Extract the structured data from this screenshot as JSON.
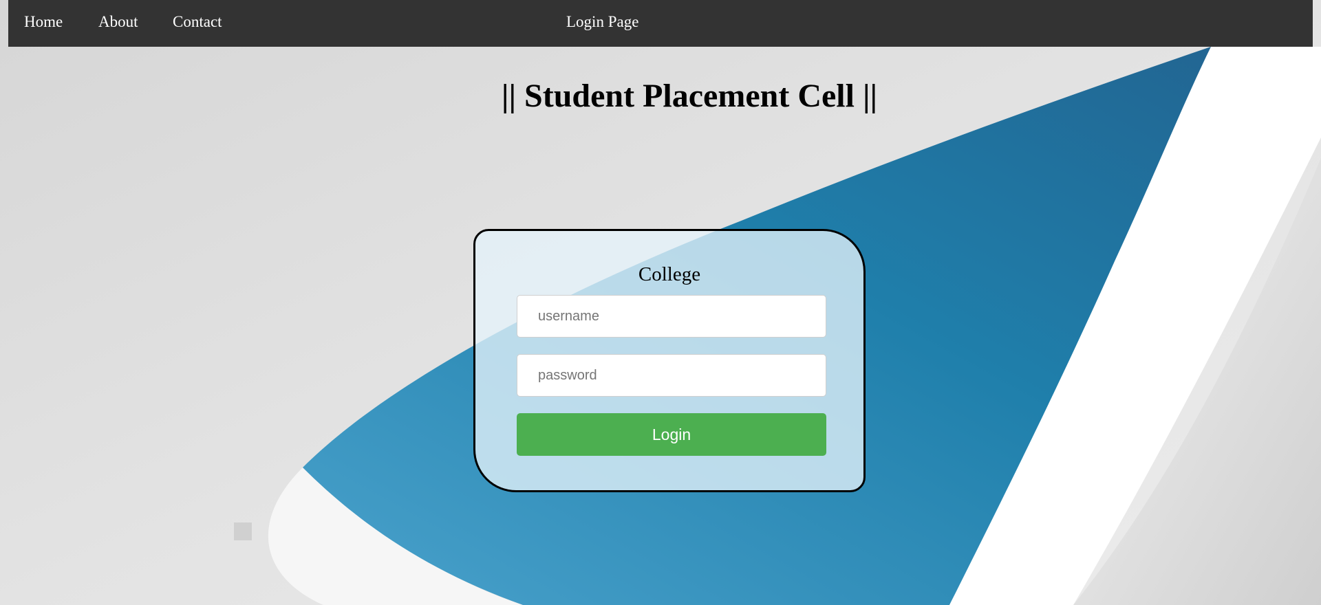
{
  "nav": {
    "home": "Home",
    "about": "About",
    "contact": "Contact",
    "page_title": "Login Page"
  },
  "heading": "|| Student Placement Cell ||",
  "login": {
    "title": "College",
    "username_placeholder": "username",
    "password_placeholder": "password",
    "button_label": "Login"
  },
  "colors": {
    "navbar": "#333333",
    "button": "#4caf50",
    "background_accent": "#2a7fb0"
  }
}
